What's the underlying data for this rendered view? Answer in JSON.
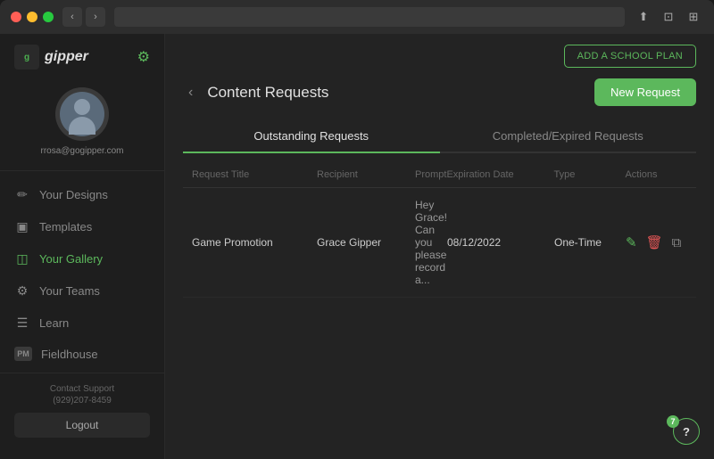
{
  "window": {
    "title": "Gipper - Content Requests"
  },
  "sidebar": {
    "logo": "gipper",
    "user": {
      "email": "rrosa@gogipper.com"
    },
    "nav_items": [
      {
        "id": "your-designs",
        "label": "Your Designs",
        "icon": "✏️",
        "icon_name": "pencil-icon",
        "active": false
      },
      {
        "id": "templates",
        "label": "Templates",
        "icon": "⊞",
        "icon_name": "grid-icon",
        "active": false
      },
      {
        "id": "your-gallery",
        "label": "Your Gallery",
        "icon": "⊟",
        "icon_name": "gallery-icon",
        "active": true
      },
      {
        "id": "your-teams",
        "label": "Your Teams",
        "icon": "⚙",
        "icon_name": "teams-icon",
        "active": false
      },
      {
        "id": "learn",
        "label": "Learn",
        "icon": "☰",
        "icon_name": "learn-icon",
        "active": false
      },
      {
        "id": "fieldhouse",
        "label": "Fieldhouse",
        "icon": "PM",
        "icon_name": "fieldhouse-icon",
        "active": false
      }
    ],
    "footer": {
      "contact_label": "Contact Support",
      "phone": "(929)207-8459",
      "logout_label": "Logout"
    }
  },
  "header": {
    "add_school_plan_label": "ADD A SCHOOL PLAN"
  },
  "content": {
    "back_icon": "‹",
    "page_title": "Content Requests",
    "new_request_label": "New Request",
    "tabs": [
      {
        "id": "outstanding",
        "label": "Outstanding Requests",
        "active": true
      },
      {
        "id": "completed",
        "label": "Completed/Expired Requests",
        "active": false
      }
    ],
    "table": {
      "columns": [
        {
          "id": "request_title",
          "label": "Request Title"
        },
        {
          "id": "recipient",
          "label": "Recipient"
        },
        {
          "id": "prompt",
          "label": "Prompt"
        },
        {
          "id": "expiration_date",
          "label": "Expiration Date"
        },
        {
          "id": "type",
          "label": "Type"
        },
        {
          "id": "actions",
          "label": "Actions"
        }
      ],
      "rows": [
        {
          "request_title": "Game Promotion",
          "recipient": "Grace Gipper",
          "prompt": "Hey Grace! Can you please record a...",
          "expiration_date": "08/12/2022",
          "type": "One-Time",
          "actions": [
            "edit",
            "delete",
            "copy"
          ]
        }
      ]
    }
  },
  "help": {
    "badge": "?",
    "count": "7"
  }
}
